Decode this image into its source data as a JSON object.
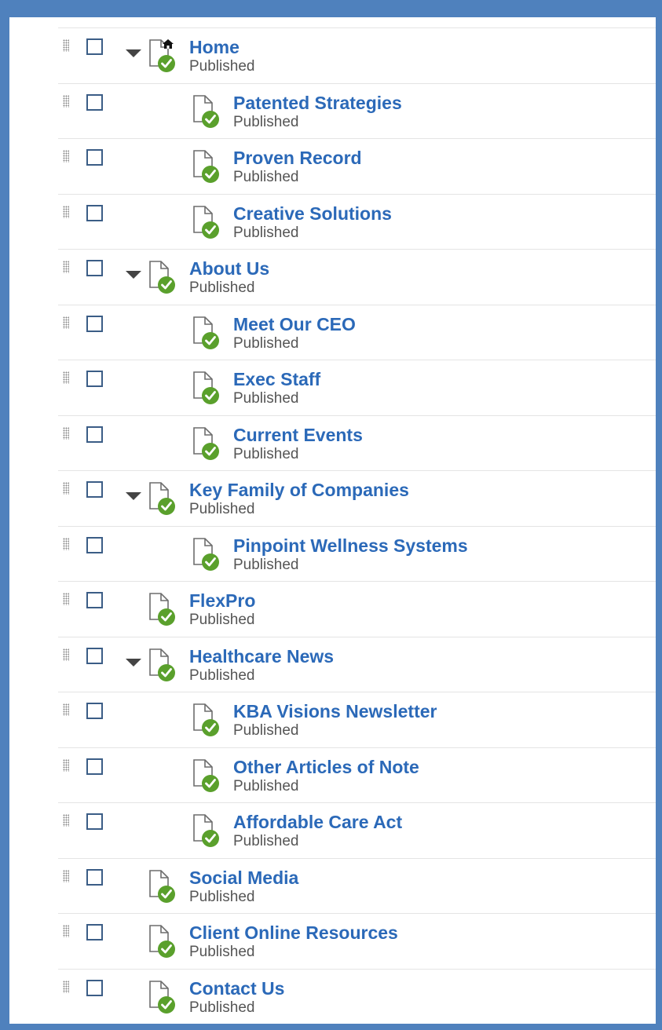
{
  "tree": {
    "items": [
      {
        "title": "Home",
        "status": "Published",
        "level": 0,
        "expandable": true,
        "home": true
      },
      {
        "title": "Patented Strategies",
        "status": "Published",
        "level": 1,
        "expandable": false,
        "home": false
      },
      {
        "title": "Proven Record",
        "status": "Published",
        "level": 1,
        "expandable": false,
        "home": false
      },
      {
        "title": "Creative Solutions",
        "status": "Published",
        "level": 1,
        "expandable": false,
        "home": false
      },
      {
        "title": "About Us",
        "status": "Published",
        "level": 0,
        "expandable": true,
        "home": false
      },
      {
        "title": "Meet Our CEO",
        "status": "Published",
        "level": 1,
        "expandable": false,
        "home": false
      },
      {
        "title": "Exec Staff",
        "status": "Published",
        "level": 1,
        "expandable": false,
        "home": false
      },
      {
        "title": "Current Events",
        "status": "Published",
        "level": 1,
        "expandable": false,
        "home": false
      },
      {
        "title": "Key Family of Companies",
        "status": "Published",
        "level": 0,
        "expandable": true,
        "home": false
      },
      {
        "title": "Pinpoint Wellness Systems",
        "status": "Published",
        "level": 1,
        "expandable": false,
        "home": false
      },
      {
        "title": "FlexPro",
        "status": "Published",
        "level": 0,
        "expandable": false,
        "home": false
      },
      {
        "title": "Healthcare News",
        "status": "Published",
        "level": 0,
        "expandable": true,
        "home": false
      },
      {
        "title": "KBA Visions Newsletter",
        "status": "Published",
        "level": 1,
        "expandable": false,
        "home": false
      },
      {
        "title": "Other Articles of Note",
        "status": "Published",
        "level": 1,
        "expandable": false,
        "home": false
      },
      {
        "title": "Affordable Care Act",
        "status": "Published",
        "level": 1,
        "expandable": false,
        "home": false
      },
      {
        "title": "Social Media",
        "status": "Published",
        "level": 0,
        "expandable": false,
        "home": false
      },
      {
        "title": "Client Online Resources",
        "status": "Published",
        "level": 0,
        "expandable": false,
        "home": false
      },
      {
        "title": "Contact Us",
        "status": "Published",
        "level": 0,
        "expandable": false,
        "home": false
      }
    ]
  },
  "icons": {
    "drag": "drag-handle-icon",
    "checkbox": "checkbox-unchecked",
    "expand": "caret-down-icon",
    "page": "page-published-icon",
    "home": "home-icon"
  },
  "colors": {
    "frame_border": "#4f81bd",
    "link": "#2b69b8",
    "status_text": "#555555",
    "published_badge": "#5aa02c",
    "checkbox_border": "#3b5d86"
  }
}
